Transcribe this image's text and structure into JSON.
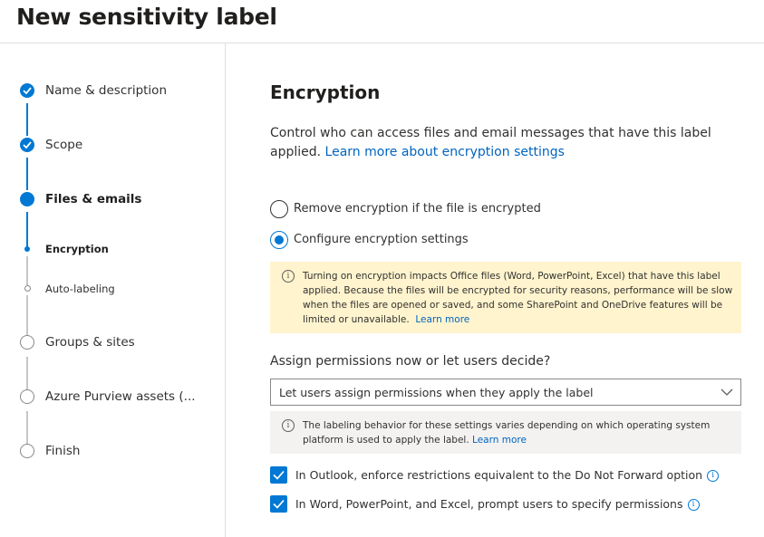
{
  "header": {
    "title": "New sensitivity label"
  },
  "sidebar": {
    "steps": [
      {
        "label": "Name & description",
        "state": "done"
      },
      {
        "label": "Scope",
        "state": "done"
      },
      {
        "label": "Files & emails",
        "state": "current"
      },
      {
        "label": "Encryption",
        "state": "current-sub"
      },
      {
        "label": "Auto-labeling",
        "state": "pending-sub"
      },
      {
        "label": "Groups & sites",
        "state": "pending"
      },
      {
        "label": "Azure Purview assets (...",
        "state": "pending"
      },
      {
        "label": "Finish",
        "state": "pending"
      }
    ]
  },
  "main": {
    "title": "Encryption",
    "intro_text": "Control who can access files and email messages that have this label applied. ",
    "intro_link": "Learn more about encryption settings",
    "radios": [
      {
        "label": "Remove encryption if the file is encrypted",
        "checked": false
      },
      {
        "label": "Configure encryption settings",
        "checked": true
      }
    ],
    "warning": {
      "text": "Turning on encryption impacts Office files (Word, PowerPoint, Excel) that have this label applied. Because the files will be encrypted for security reasons, performance will be slow when the files are opened or saved, and some SharePoint and OneDrive features will be limited or unavailable.",
      "link": "Learn more"
    },
    "permissions_question": "Assign permissions now or let users decide?",
    "permissions_select": {
      "value": "Let users assign permissions when they apply the label"
    },
    "note": {
      "text": "The labeling behavior for these settings varies depending on which operating system platform is used to apply the label.",
      "link": "Learn more"
    },
    "checkboxes": [
      {
        "label": "In Outlook, enforce restrictions equivalent to the Do Not Forward option",
        "checked": true
      },
      {
        "label": "In Word, PowerPoint, and Excel, prompt users to specify permissions",
        "checked": true
      }
    ]
  },
  "colors": {
    "accent": "#0078d4",
    "warning_bg": "#fff4ce",
    "note_bg": "#f3f2f1",
    "link": "#0064bf"
  }
}
